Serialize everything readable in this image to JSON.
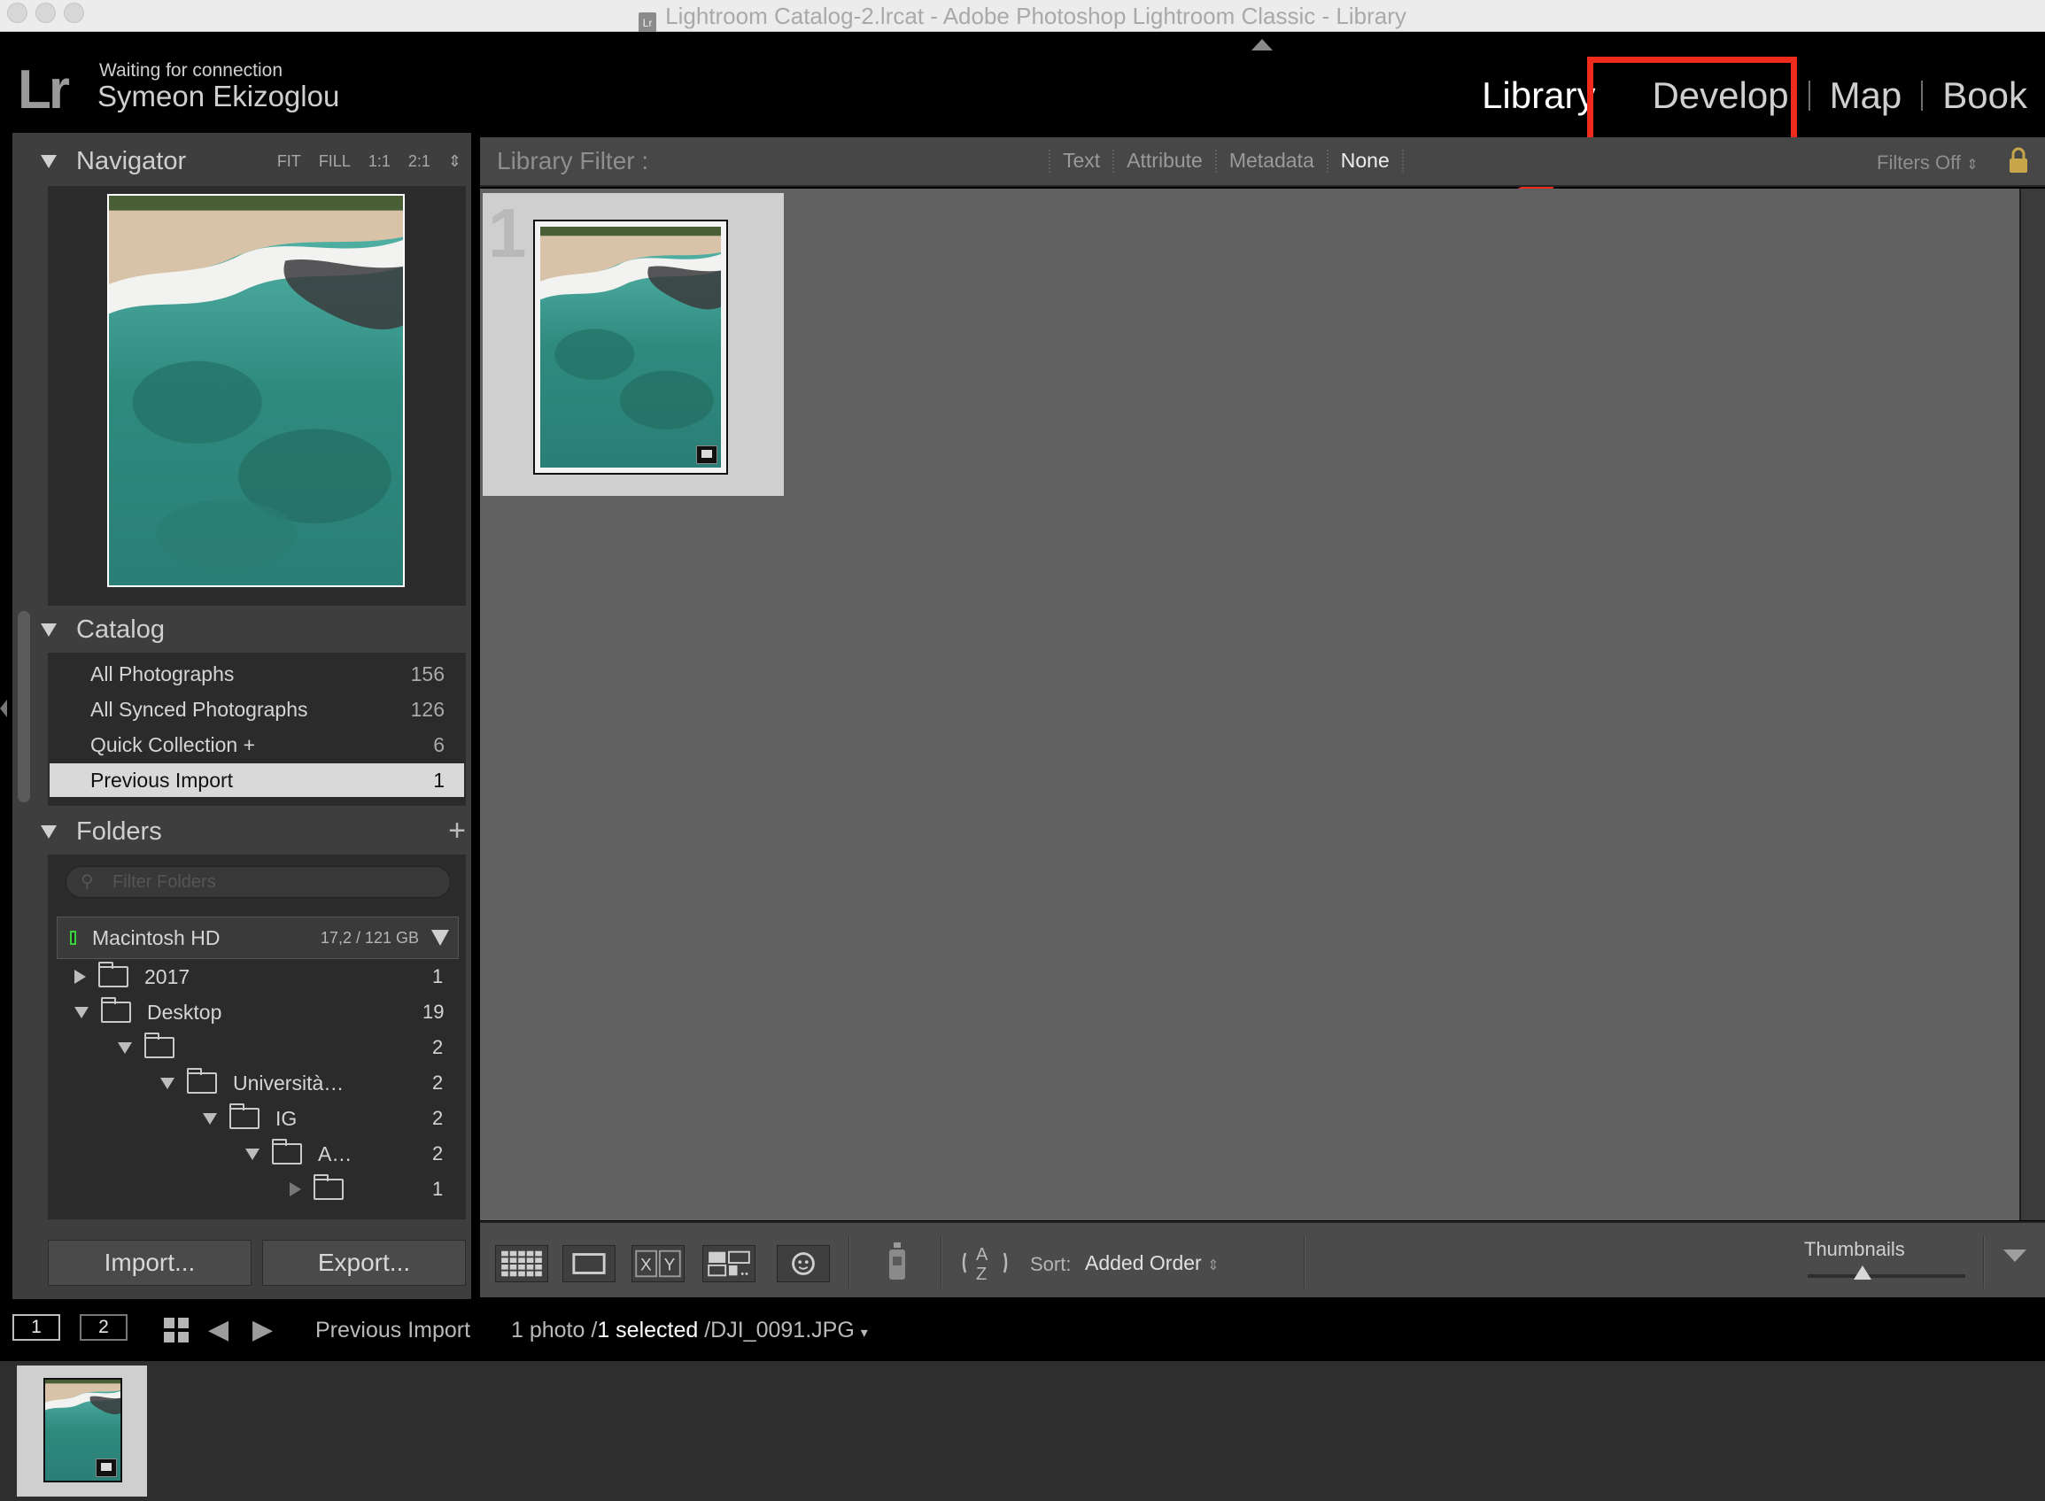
{
  "window": {
    "title": "Lightroom Catalog-2.lrcat - Adobe Photoshop Lightroom Classic - Library",
    "doc_icon_label": "Lr"
  },
  "identity": {
    "logo": "Lr",
    "status": "Waiting for connection",
    "user": "Symeon Ekizoglou"
  },
  "modules": [
    {
      "label": "Library",
      "active": true
    },
    {
      "label": "Develop",
      "active": false,
      "highlighted": true
    },
    {
      "label": "Map",
      "active": false
    },
    {
      "label": "Book",
      "active": false
    }
  ],
  "annotation": {
    "box_color": "#ef2b1d",
    "arrow_color": "#ef2b1d"
  },
  "navigator": {
    "title": "Navigator",
    "zoom_options": [
      "FIT",
      "FILL",
      "1:1",
      "2:1"
    ]
  },
  "catalog": {
    "title": "Catalog",
    "items": [
      {
        "label": "All Photographs",
        "count": "156"
      },
      {
        "label": "All Synced Photographs",
        "count": "126"
      },
      {
        "label": "Quick Collection +",
        "count": "6"
      },
      {
        "label": "Previous Import",
        "count": "1",
        "selected": true
      }
    ]
  },
  "folders": {
    "title": "Folders",
    "add_label": "+",
    "filter_placeholder": "Filter Folders",
    "volume": {
      "name": "Macintosh HD",
      "size": "17,2 / 121 GB"
    },
    "tree": [
      {
        "name": "2017",
        "count": "1",
        "expanded": false
      },
      {
        "name": "Desktop",
        "count": "19",
        "expanded": true
      },
      {
        "name": "",
        "count": "2",
        "expanded": true
      },
      {
        "name": "Università…",
        "count": "2",
        "expanded": true
      },
      {
        "name": "IG",
        "count": "2",
        "expanded": true
      },
      {
        "name": "A…",
        "count": "2",
        "expanded": true
      },
      {
        "name": "",
        "count": "1",
        "expanded": false
      }
    ]
  },
  "buttons": {
    "import": "Import...",
    "export": "Export..."
  },
  "library_filter": {
    "label": "Library Filter :",
    "options": [
      "Text",
      "Attribute",
      "Metadata",
      "None"
    ],
    "active": "None",
    "filters_state": "Filters Off"
  },
  "grid": {
    "cells": [
      {
        "index": "1",
        "file": "DJI_0091.JPG"
      }
    ]
  },
  "toolbar": {
    "sort_label": "Sort:",
    "sort_value": "Added Order",
    "thumbnails_label": "Thumbnails",
    "thumbnail_size": 0.35,
    "view_icons": [
      "grid-view-icon",
      "loupe-view-icon",
      "compare-view-icon",
      "survey-view-icon",
      "people-view-icon",
      "painter-icon",
      "sort-direction-icon"
    ]
  },
  "filmstrip": {
    "screen_buttons": [
      "1",
      "2"
    ],
    "source": "Previous Import",
    "count_text": "1 photo /",
    "selected_text": "1 selected",
    "file_text": "/DJI_0091.JPG"
  }
}
